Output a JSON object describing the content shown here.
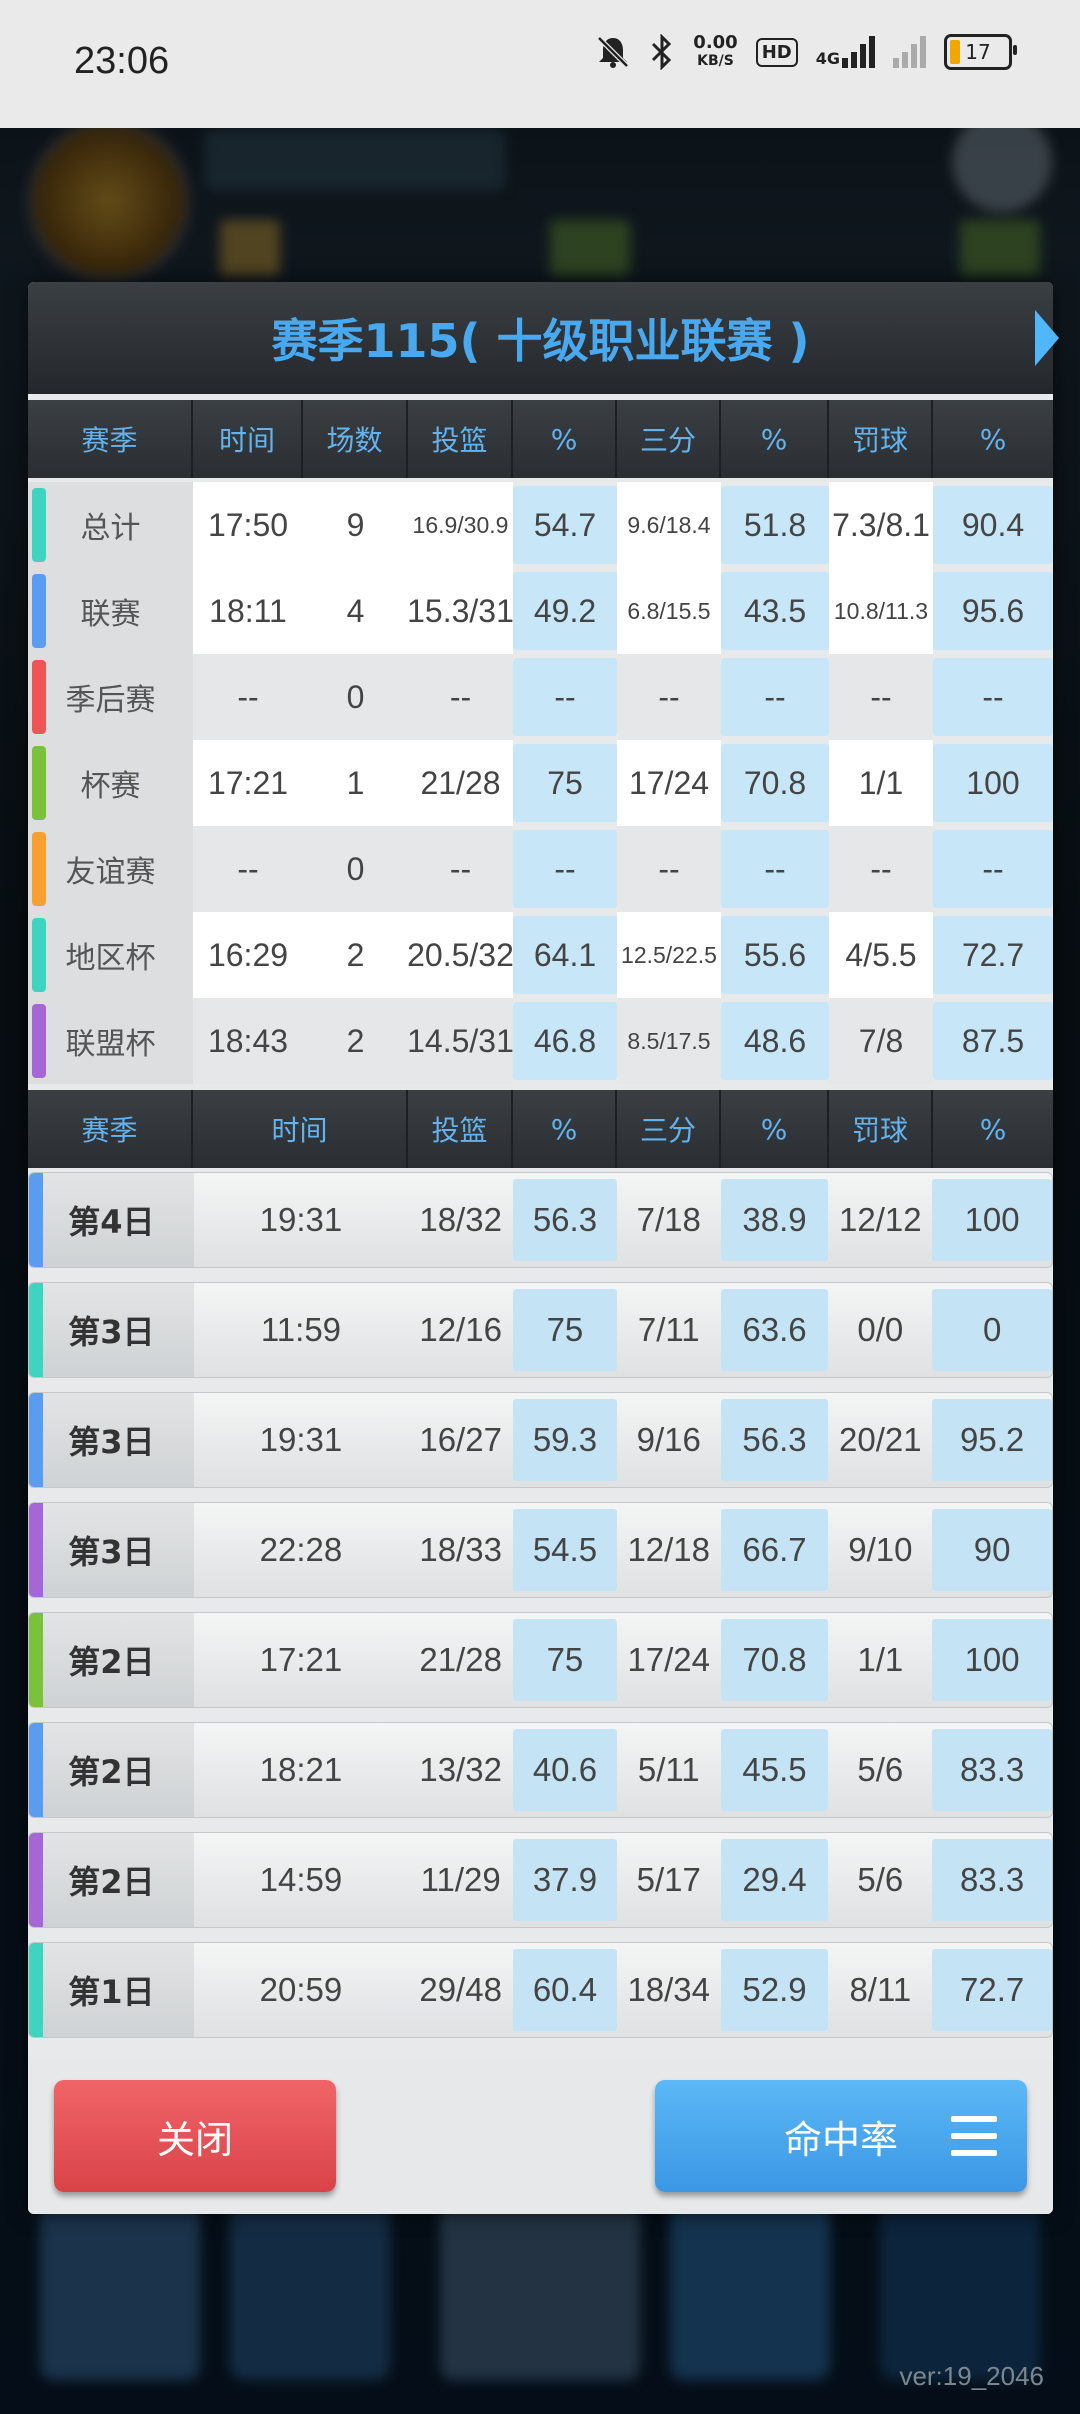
{
  "status_bar": {
    "time": "23:06",
    "net_speed_value": "0.00",
    "net_speed_unit": "KB/S",
    "hd_label": "HD",
    "network_type": "4G",
    "battery_level": "17"
  },
  "dialog": {
    "title": "赛季115( 十级职业联赛 )",
    "season_table": {
      "headers": [
        "赛季",
        "时间",
        "场数",
        "投篮",
        "%",
        "三分",
        "%",
        "罚球",
        "%"
      ],
      "rows": [
        {
          "label": "总计",
          "color": "#3fd4c0",
          "time": "17:50",
          "games": "9",
          "fg": "16.9/30.9",
          "fg_pct": "54.7",
          "three": "9.6/18.4",
          "three_pct": "51.8",
          "ft": "7.3/8.1",
          "ft_pct": "90.4"
        },
        {
          "label": "联赛",
          "color": "#5a9df0",
          "time": "18:11",
          "games": "4",
          "fg": "15.3/31",
          "fg_pct": "49.2",
          "three": "6.8/15.5",
          "three_pct": "43.5",
          "ft": "10.8/11.3",
          "ft_pct": "95.6"
        },
        {
          "label": "季后赛",
          "color": "#f05555",
          "time": "--",
          "games": "0",
          "fg": "--",
          "fg_pct": "--",
          "three": "--",
          "three_pct": "--",
          "ft": "--",
          "ft_pct": "--"
        },
        {
          "label": "杯赛",
          "color": "#7ac23a",
          "time": "17:21",
          "games": "1",
          "fg": "21/28",
          "fg_pct": "75",
          "three": "17/24",
          "three_pct": "70.8",
          "ft": "1/1",
          "ft_pct": "100"
        },
        {
          "label": "友谊赛",
          "color": "#f5a030",
          "time": "--",
          "games": "0",
          "fg": "--",
          "fg_pct": "--",
          "three": "--",
          "three_pct": "--",
          "ft": "--",
          "ft_pct": "--"
        },
        {
          "label": "地区杯",
          "color": "#3fd4c0",
          "time": "16:29",
          "games": "2",
          "fg": "20.5/32",
          "fg_pct": "64.1",
          "three": "12.5/22.5",
          "three_pct": "55.6",
          "ft": "4/5.5",
          "ft_pct": "72.7"
        },
        {
          "label": "联盟杯",
          "color": "#a566d6",
          "time": "18:43",
          "games": "2",
          "fg": "14.5/31",
          "fg_pct": "46.8",
          "three": "8.5/17.5",
          "three_pct": "48.6",
          "ft": "7/8",
          "ft_pct": "87.5"
        }
      ]
    },
    "game_table": {
      "headers": [
        "赛季",
        "时间",
        "投篮",
        "%",
        "三分",
        "%",
        "罚球",
        "%"
      ],
      "rows": [
        {
          "label": "第4日",
          "color": "#5a9df0",
          "time": "19:31",
          "fg": "18/32",
          "fg_pct": "56.3",
          "three": "7/18",
          "three_pct": "38.9",
          "ft": "12/12",
          "ft_pct": "100"
        },
        {
          "label": "第3日",
          "color": "#3fd4c0",
          "time": "11:59",
          "fg": "12/16",
          "fg_pct": "75",
          "three": "7/11",
          "three_pct": "63.6",
          "ft": "0/0",
          "ft_pct": "0"
        },
        {
          "label": "第3日",
          "color": "#5a9df0",
          "time": "19:31",
          "fg": "16/27",
          "fg_pct": "59.3",
          "three": "9/16",
          "three_pct": "56.3",
          "ft": "20/21",
          "ft_pct": "95.2"
        },
        {
          "label": "第3日",
          "color": "#a566d6",
          "time": "22:28",
          "fg": "18/33",
          "fg_pct": "54.5",
          "three": "12/18",
          "three_pct": "66.7",
          "ft": "9/10",
          "ft_pct": "90"
        },
        {
          "label": "第2日",
          "color": "#7ac23a",
          "time": "17:21",
          "fg": "21/28",
          "fg_pct": "75",
          "three": "17/24",
          "three_pct": "70.8",
          "ft": "1/1",
          "ft_pct": "100"
        },
        {
          "label": "第2日",
          "color": "#5a9df0",
          "time": "18:21",
          "fg": "13/32",
          "fg_pct": "40.6",
          "three": "5/11",
          "three_pct": "45.5",
          "ft": "5/6",
          "ft_pct": "83.3"
        },
        {
          "label": "第2日",
          "color": "#a566d6",
          "time": "14:59",
          "fg": "11/29",
          "fg_pct": "37.9",
          "three": "5/17",
          "three_pct": "29.4",
          "ft": "5/6",
          "ft_pct": "83.3"
        },
        {
          "label": "第1日",
          "color": "#3fd4c0",
          "time": "20:59",
          "fg": "29/48",
          "fg_pct": "60.4",
          "three": "18/34",
          "three_pct": "52.9",
          "ft": "8/11",
          "ft_pct": "72.7"
        }
      ]
    },
    "close_button": "关闭",
    "sort_button": "命中率",
    "icons": {
      "next": "chevron-right-icon",
      "menu": "menu-icon"
    }
  },
  "version": "ver:19_2046"
}
